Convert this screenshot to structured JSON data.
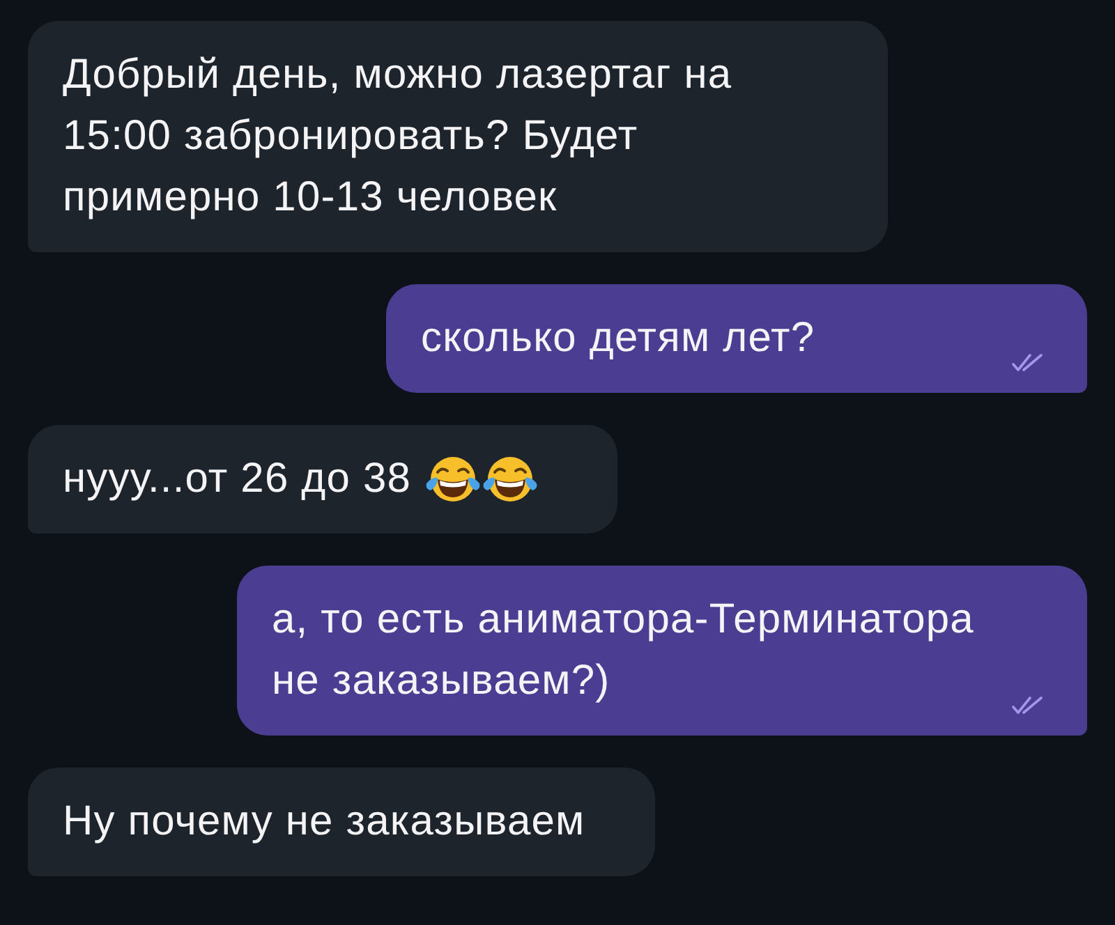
{
  "messages": [
    {
      "kind": "incoming",
      "text": "Добрый день, можно лазертаг на 15:00 забронировать? Будет примерно 10-13 человек"
    },
    {
      "kind": "outgoing",
      "text": "сколько детям лет?",
      "read": true
    },
    {
      "kind": "incoming",
      "text": "нууу...от 26 до 38",
      "emoji": [
        {
          "kind": "tears-of-joy"
        },
        {
          "kind": "tears-of-joy"
        }
      ]
    },
    {
      "kind": "outgoing",
      "text": "а, то есть аниматора-Терминатора не заказываем?)",
      "read": true
    },
    {
      "kind": "incoming",
      "text": "Ну почему не заказываем"
    }
  ]
}
